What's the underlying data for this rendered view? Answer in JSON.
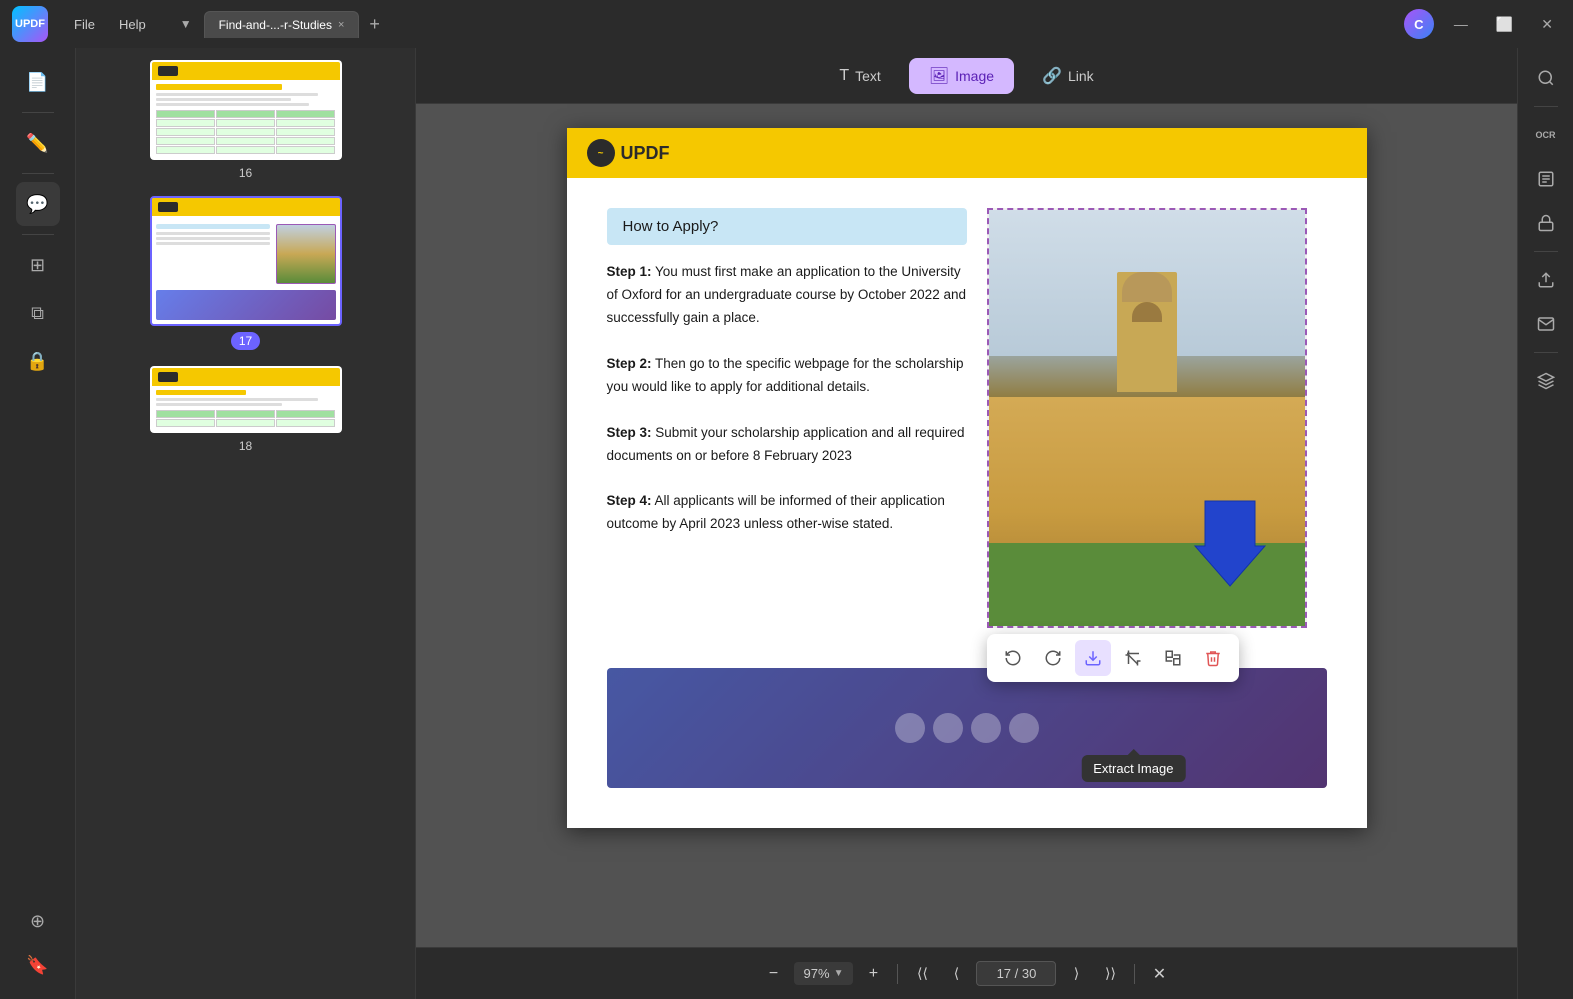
{
  "app": {
    "logo_text": "UPDF",
    "title": "UPDF"
  },
  "titlebar": {
    "menu_items": [
      "File",
      "Help"
    ],
    "tab_label": "Find-and-...-r-Studies",
    "tab_dropdown": "▼",
    "tab_close": "×",
    "tab_add": "+",
    "avatar_letter": "C",
    "win_minimize": "—",
    "win_maximize": "⬜",
    "win_close": "✕"
  },
  "toolbar": {
    "text_label": "Text",
    "image_label": "Image",
    "link_label": "Link"
  },
  "left_sidebar": {
    "icons": [
      {
        "name": "document-icon",
        "symbol": "📄"
      },
      {
        "name": "edit-icon",
        "symbol": "✏️"
      },
      {
        "name": "comment-icon",
        "symbol": "💬"
      },
      {
        "name": "organize-icon",
        "symbol": "⊞"
      },
      {
        "name": "copy-icon",
        "symbol": "⧉"
      },
      {
        "name": "security-icon",
        "symbol": "🔒"
      },
      {
        "name": "layers-icon",
        "symbol": "⊕"
      },
      {
        "name": "bookmark-icon",
        "symbol": "🔖"
      }
    ]
  },
  "thumbnails": [
    {
      "page_number": "16",
      "selected": false
    },
    {
      "page_number": "17",
      "selected": true
    },
    {
      "page_number": "18",
      "selected": false
    }
  ],
  "page_content": {
    "updf_logo": "UPDF",
    "section_title": "How to Apply?",
    "step1_label": "Step 1:",
    "step1_text": "You must first make an application to the University of Oxford for an undergraduate course by October 2022 and successfully gain a place.",
    "step2_label": "Step 2:",
    "step2_text": "Then go to the specific webpage for the scholarship you would like to apply for additional details.",
    "step3_label": "Step 3:",
    "step3_text": "Submit your scholarship application and all required documents on or before 8 February 2023",
    "step4_label": "Step 4:",
    "step4_text": "All applicants will be informed of their application outcome by April 2023 unless other-wise stated."
  },
  "image_toolbar": {
    "btn1": "⬚",
    "btn2": "⬓",
    "btn3": "⬔",
    "btn4": "⬕",
    "btn5": "⬖",
    "btn6": "🗑",
    "active_btn_index": 2,
    "tooltip": "Extract Image"
  },
  "bottom_toolbar": {
    "zoom_out": "−",
    "zoom_level": "97%",
    "zoom_in": "+",
    "nav_first": "⟨⟨",
    "nav_prev": "⟨",
    "current_page": "17",
    "total_pages": "30",
    "nav_next": "⟩",
    "nav_last": "⟩⟩",
    "separator": "|",
    "close": "✕"
  },
  "right_sidebar": {
    "icons": [
      {
        "name": "search-icon",
        "symbol": "🔍"
      },
      {
        "name": "ocr-icon",
        "symbol": "OCR"
      },
      {
        "name": "scan-icon",
        "symbol": "⊡"
      },
      {
        "name": "protect-icon",
        "symbol": "🔒"
      },
      {
        "name": "share-icon",
        "symbol": "↑"
      },
      {
        "name": "email-icon",
        "symbol": "✉"
      },
      {
        "name": "backup-icon",
        "symbol": "💾"
      }
    ]
  }
}
